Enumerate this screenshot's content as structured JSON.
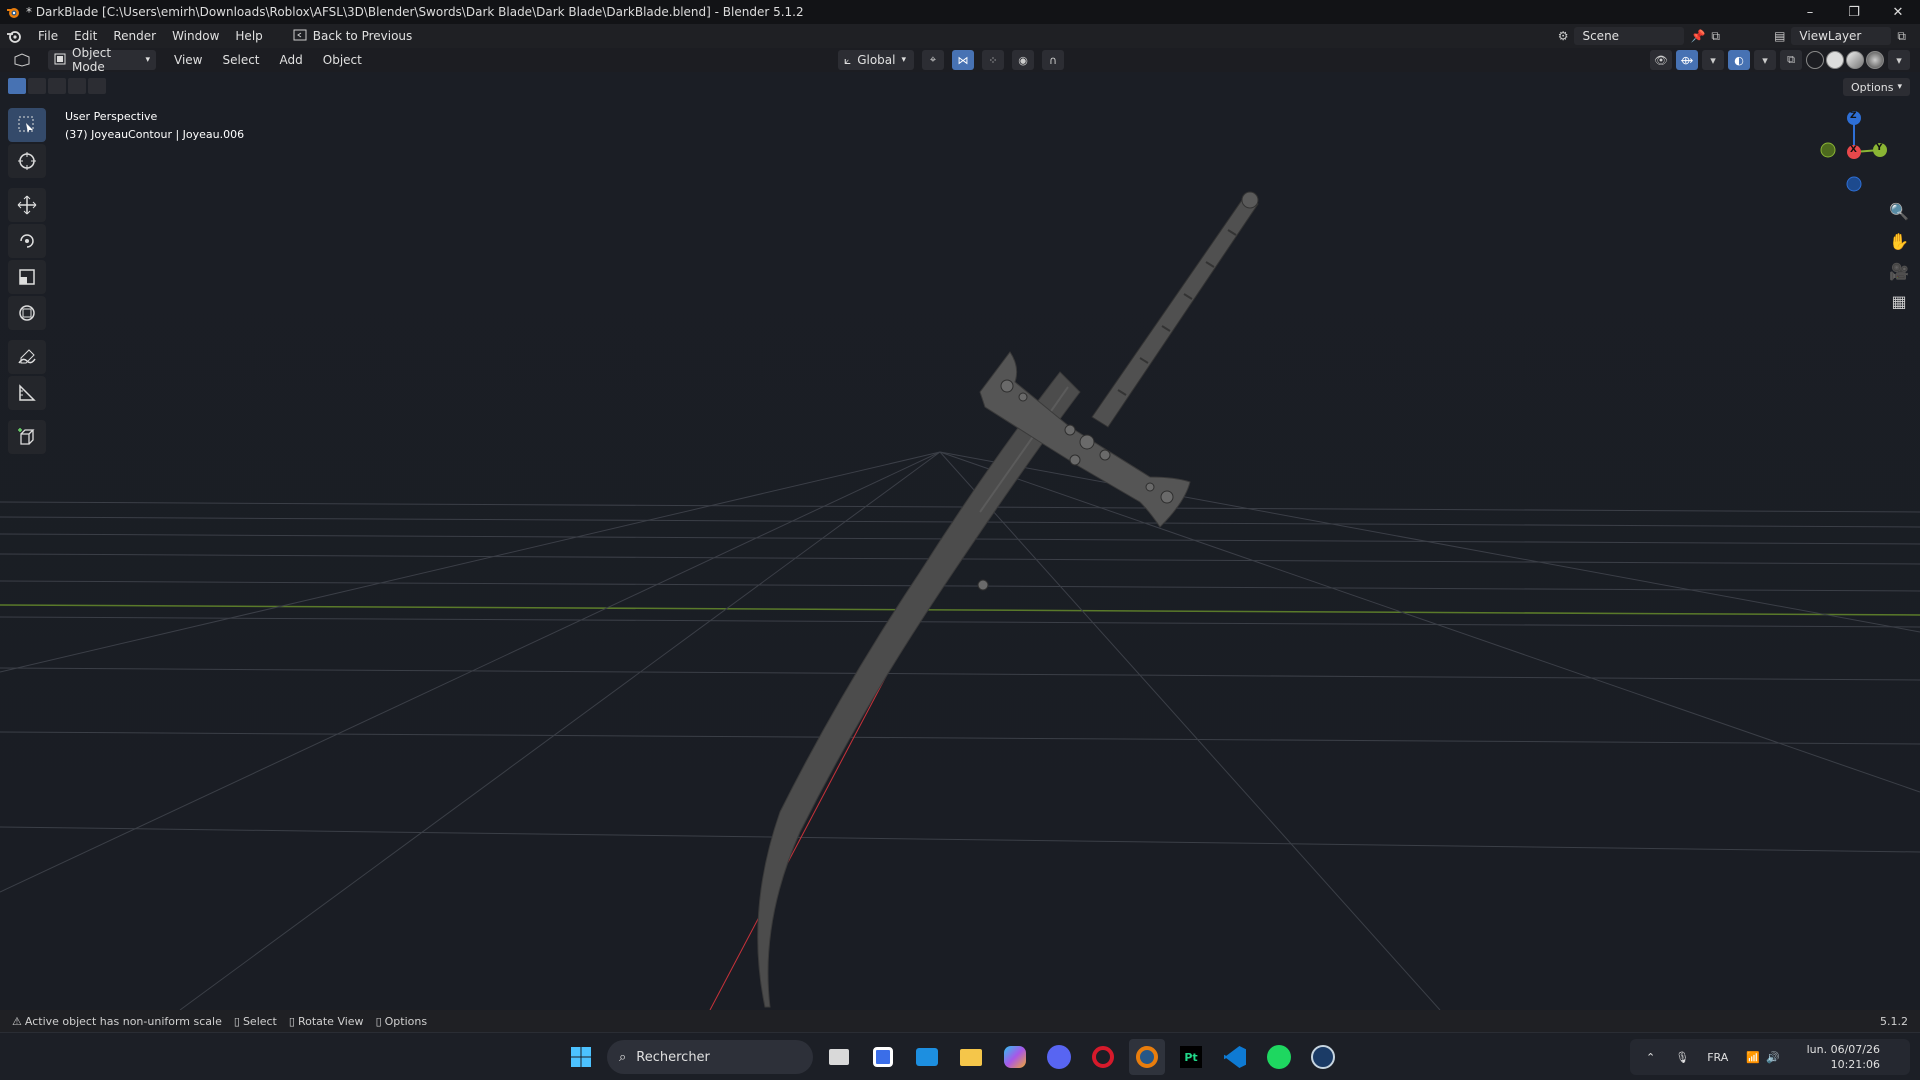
{
  "window": {
    "title": "* DarkBlade [C:\\Users\\emirh\\Downloads\\Roblox\\AFSL\\3D\\Blender\\Swords\\Dark Blade\\Dark Blade\\DarkBlade.blend] - Blender 5.1.2",
    "minimize": "–",
    "restore": "❐",
    "close": "✕"
  },
  "topbar": {
    "menus": [
      "File",
      "Edit",
      "Render",
      "Window",
      "Help"
    ],
    "back_label": "Back to Previous",
    "scene_label": "Scene",
    "viewlayer_label": "ViewLayer"
  },
  "header": {
    "mode": "Object Mode",
    "menus": [
      "View",
      "Select",
      "Add",
      "Object"
    ],
    "transform_orientation": "Global",
    "options_label": "Options"
  },
  "viewport": {
    "perspective_label": "User Perspective",
    "object_label": "(37) JoyeauContour | Joyeau.006"
  },
  "gizmo": {
    "x": "X",
    "y": "Y",
    "z": "Z"
  },
  "statusbar": {
    "warning": "Active object has non-uniform scale",
    "select": "Select",
    "rotate": "Rotate View",
    "options": "Options",
    "version": "5.1.2"
  },
  "taskbar": {
    "search_placeholder": "Rechercher",
    "language": "FRA",
    "date": "lun. 06/07/26",
    "time": "10:21:06"
  },
  "colors": {
    "accent": "#4772b3",
    "axis_x": "#e8484b",
    "axis_y": "#8ab534",
    "axis_z": "#2e6fd6"
  }
}
